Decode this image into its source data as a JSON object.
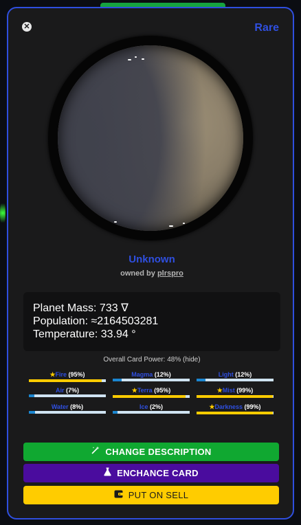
{
  "card": {
    "close_glyph": "✕",
    "rarity": "Rare",
    "planet_name": "Unknown",
    "owned_by_prefix": "owned by",
    "owner": "plrspro"
  },
  "stats": {
    "mass": "Planet Mass: 733 ∇",
    "population": "Population: ≈2164503281",
    "temperature": "Temperature: 33.94 °"
  },
  "power_line": "Overall Card Power: 48% (hide)",
  "elements": [
    {
      "name": "Fire",
      "pct": "(95%)",
      "starred": true,
      "value": 0.95,
      "color": "#ffcc00"
    },
    {
      "name": "Magma",
      "pct": "(12%)",
      "starred": false,
      "value": 0.12,
      "color": "#1b86d0"
    },
    {
      "name": "Light",
      "pct": "(12%)",
      "starred": false,
      "value": 0.12,
      "color": "#1b86d0"
    },
    {
      "name": "Air",
      "pct": "(7%)",
      "starred": false,
      "value": 0.07,
      "color": "#1b86d0"
    },
    {
      "name": "Terra",
      "pct": "(95%)",
      "starred": true,
      "value": 0.95,
      "color": "#ffcc00"
    },
    {
      "name": "Mist",
      "pct": "(99%)",
      "starred": true,
      "value": 0.99,
      "color": "#ffcc00"
    },
    {
      "name": "Water",
      "pct": "(8%)",
      "starred": false,
      "value": 0.08,
      "color": "#1b86d0"
    },
    {
      "name": "Ice",
      "pct": "(2%)",
      "starred": false,
      "value": 0.02,
      "color": "#1b86d0"
    },
    {
      "name": "Darkness",
      "pct": "(99%)",
      "starred": true,
      "value": 0.99,
      "color": "#ffcc00"
    }
  ],
  "buttons": {
    "change_description": "CHANGE DESCRIPTION",
    "change_icon": "wand-icon",
    "enchance": "ENCHANCE CARD",
    "enchance_icon": "flask-icon",
    "sell": "PUT ON SELL",
    "sell_icon": "wallet-icon"
  },
  "colors": {
    "accent": "#2f4fe0",
    "green": "#10a831",
    "purple": "#4a0c9e",
    "yellow": "#ffcc00"
  }
}
